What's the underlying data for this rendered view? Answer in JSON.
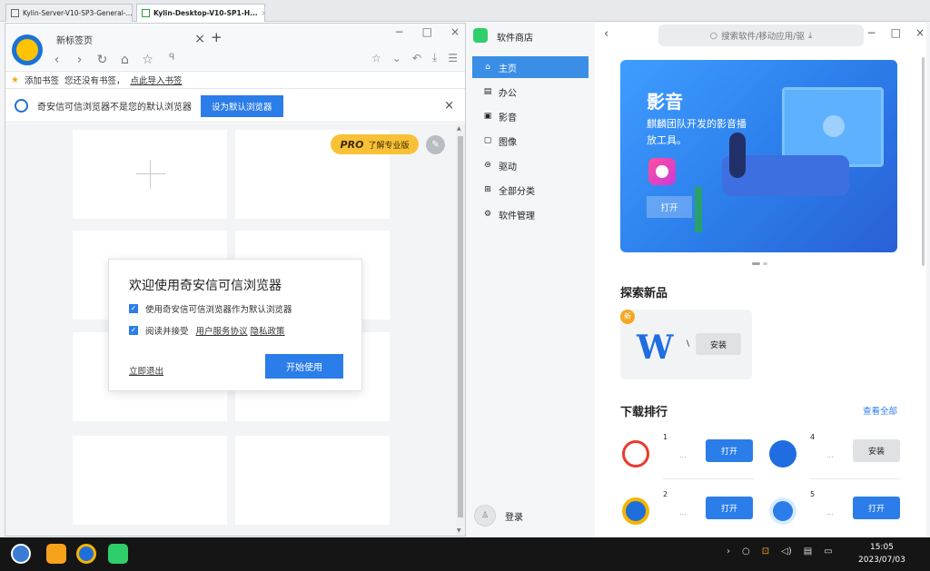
{
  "vm_tabs": [
    {
      "label": "Kylin-Server-V10-SP3-General-...",
      "close": "×"
    },
    {
      "label": "Kylin-Desktop-V10-SP1-H...",
      "close": "×"
    }
  ],
  "browser": {
    "tab_title": "新标签页",
    "tab_close": "×",
    "new_tab": "+",
    "window_controls": [
      "−",
      "□",
      "×"
    ],
    "nav": [
      "‹",
      "›",
      "↻",
      "⌂",
      "☆"
    ],
    "address_icon": "ᑫ",
    "tools": [
      "☆",
      "⌄",
      "↶",
      "⤓",
      "☰"
    ],
    "bookmarks": {
      "star": "★",
      "add_label": "添加书签",
      "empty_text": "您还没有书签，",
      "import_link": "点此导入书签"
    },
    "default_bar": {
      "text": "奇安信可信浏览器不是您的默认浏览器",
      "button": "设为默认浏览器",
      "close": "×"
    },
    "pro": {
      "logo": "PRO",
      "label": "了解专业版"
    },
    "edit_icon": "✎",
    "welcome": {
      "title": "欢迎使用奇安信可信浏览器",
      "option1": "使用奇安信可信浏览器作为默认浏览器",
      "option2_prefix": "阅读并接受",
      "option2_link1": "用户服务协议",
      "option2_link2": "隐私政策",
      "exit": "立即退出",
      "start": "开始使用",
      "check": "✓"
    }
  },
  "store": {
    "app_name": "软件商店",
    "nav": [
      {
        "label": "主页",
        "icon": "⌂",
        "active": true
      },
      {
        "label": "办公",
        "icon": "▤"
      },
      {
        "label": "影音",
        "icon": "▣"
      },
      {
        "label": "图像",
        "icon": "▢"
      },
      {
        "label": "驱动",
        "icon": "⊜"
      },
      {
        "label": "全部分类",
        "icon": "⊞"
      },
      {
        "label": "软件管理",
        "icon": "⚙"
      }
    ],
    "login": {
      "label": "登录",
      "avatar": "♙"
    },
    "back": "‹",
    "search_placeholder": "搜索软件/移动应用/驱",
    "search_icon": "○",
    "window_controls": [
      "−",
      "□",
      "×"
    ],
    "banner": {
      "title": "影音",
      "desc": "麒麟团队开发的影音播放工具。",
      "open": "打开"
    },
    "new_section": {
      "title": "探索新品",
      "badge": "新",
      "app_icon": "W",
      "app_name": "\\",
      "install": "安装"
    },
    "rank": {
      "title": "下载排行",
      "see_all": "查看全部",
      "items": [
        {
          "num": "1",
          "dots": "...",
          "button": "打开",
          "state": "open",
          "color": "#e83b2b"
        },
        {
          "num": "4",
          "dots": "...",
          "button": "安装",
          "state": "install",
          "color": "#1f6de0"
        },
        {
          "num": "2",
          "dots": "...",
          "button": "打开",
          "state": "open",
          "color": "#f6b400"
        },
        {
          "num": "5",
          "dots": "...",
          "button": "打开",
          "state": "open",
          "color": "#2b7de9"
        }
      ]
    }
  },
  "taskbar": {
    "tray": [
      "›",
      "○",
      "⊡",
      "◁)",
      "▤",
      "▭"
    ],
    "time": "15:05",
    "date": "2023/07/03"
  }
}
